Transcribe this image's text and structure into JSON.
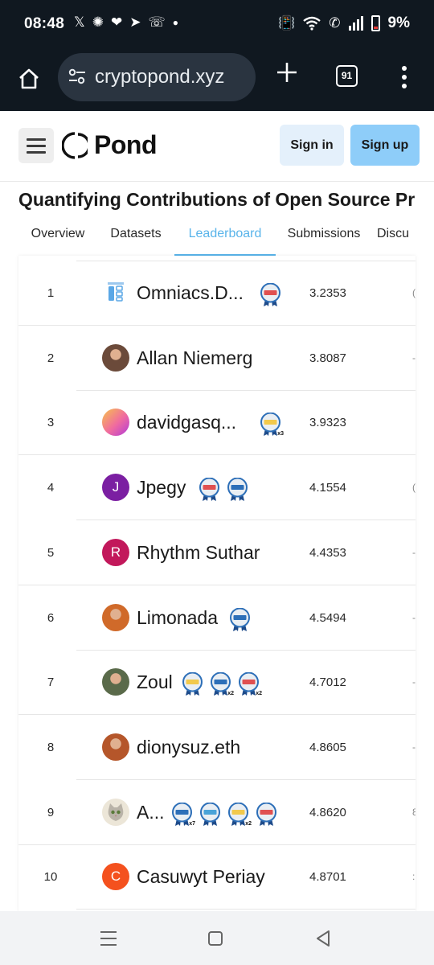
{
  "status_bar": {
    "time": "08:48",
    "battery": "9%",
    "notification_icons": [
      "x-icon",
      "gear-icon",
      "chat-icon",
      "telegram-icon",
      "missed-call-icon",
      "dot-icon"
    ],
    "system_icons": [
      "vibrate-icon",
      "wifi-icon",
      "wifi-call-icon",
      "signal-icon",
      "battery-icon"
    ]
  },
  "browser": {
    "url": "cryptopond.xyz",
    "tab_count": "91"
  },
  "site_header": {
    "logo_text": "Pond",
    "sign_in": "Sign in",
    "sign_up": "Sign up"
  },
  "page": {
    "title": "Quantifying Contributions of Open Source Pr",
    "tabs": [
      {
        "label": "Overview",
        "active": false
      },
      {
        "label": "Datasets",
        "active": false
      },
      {
        "label": "Leaderboard",
        "active": true
      },
      {
        "label": "Submissions",
        "active": false
      },
      {
        "label": "Discu",
        "active": false
      }
    ]
  },
  "leaderboard": {
    "rows": [
      {
        "rank": "1",
        "name": "Omniacs.D...",
        "score": "3.2353",
        "avatar": "omniacs-logo",
        "avatar_color": "#e8eef7",
        "badges": [
          {
            "color": "#e05050",
            "multiplier": ""
          }
        ],
        "cut": "("
      },
      {
        "rank": "2",
        "name": "Allan Niemerg",
        "score": "3.8087",
        "avatar": "photo",
        "avatar_color": "#6b4a3a",
        "badges": [],
        "cut": "-"
      },
      {
        "rank": "3",
        "name": "davidgasq...",
        "score": "3.9323",
        "avatar": "gradient",
        "avatar_color": "#f06aa0",
        "badges": [
          {
            "color": "#f2c94c",
            "multiplier": "x3"
          }
        ],
        "cut": ""
      },
      {
        "rank": "4",
        "name": "Jpegy",
        "score": "4.1554",
        "avatar_letter": "J",
        "avatar_color": "#7b1fa2",
        "badges": [
          {
            "color": "#e05050",
            "multiplier": ""
          },
          {
            "color": "#2d6fb8",
            "multiplier": ""
          }
        ],
        "cut": "("
      },
      {
        "rank": "5",
        "name": "Rhythm Suthar",
        "score": "4.4353",
        "avatar_letter": "R",
        "avatar_color": "#c2185b",
        "badges": [],
        "cut": "-"
      },
      {
        "rank": "6",
        "name": "Limonada",
        "score": "4.5494",
        "avatar": "photo",
        "avatar_color": "#d06a2a",
        "badges": [
          {
            "color": "#2d6fb8",
            "multiplier": ""
          }
        ],
        "cut": "-"
      },
      {
        "rank": "7",
        "name": "Zoul",
        "score": "4.7012",
        "avatar": "photo",
        "avatar_color": "#5a6a4a",
        "badges": [
          {
            "color": "#f2c94c",
            "multiplier": ""
          },
          {
            "color": "#2d6fb8",
            "multiplier": "x2"
          },
          {
            "color": "#e05050",
            "multiplier": "x2"
          }
        ],
        "cut": "-"
      },
      {
        "rank": "8",
        "name": "dionysuz.eth",
        "score": "4.8605",
        "avatar": "photo",
        "avatar_color": "#b5562a",
        "badges": [],
        "cut": "-"
      },
      {
        "rank": "9",
        "name": "A...",
        "score": "4.8620",
        "avatar": "cat",
        "avatar_color": "#ece6d8",
        "badges": [
          {
            "color": "#2d6fb8",
            "multiplier": "x7"
          },
          {
            "color": "#4aa3d8",
            "multiplier": ""
          },
          {
            "color": "#f2c94c",
            "multiplier": "x2"
          },
          {
            "color": "#e05050",
            "multiplier": ""
          }
        ],
        "cut": "8"
      },
      {
        "rank": "10",
        "name": "Casuwyt Periay",
        "score": "4.8701",
        "avatar_letter": "C",
        "avatar_color": "#f4511e",
        "badges": [],
        "cut": ":"
      }
    ]
  },
  "nav_bar": {
    "icons": [
      "recent-apps-icon",
      "home-icon",
      "back-icon"
    ]
  }
}
